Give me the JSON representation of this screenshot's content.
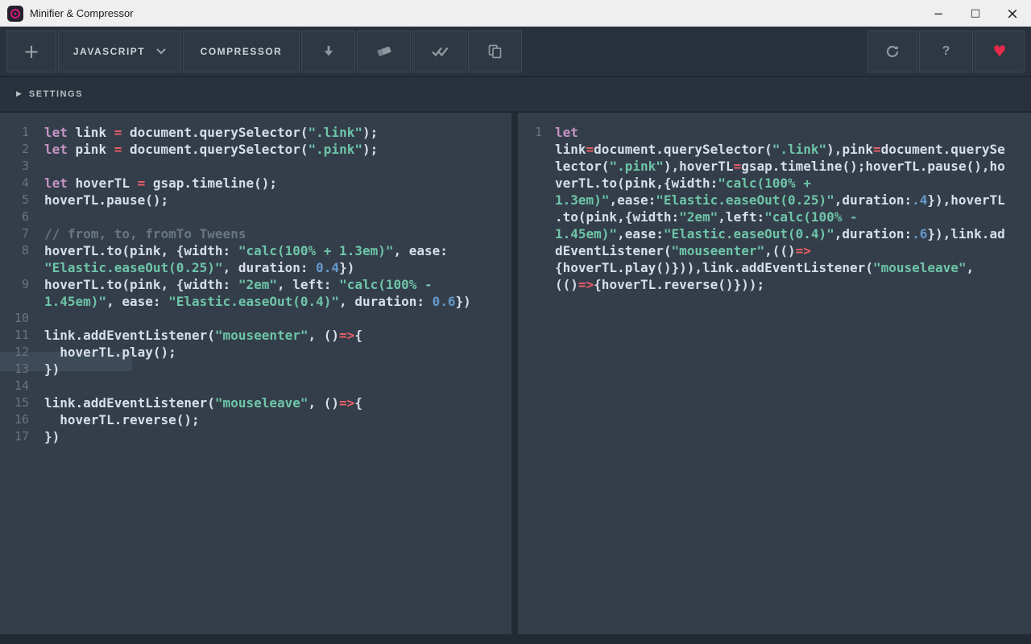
{
  "window": {
    "title": "Minifier & Compressor",
    "controls": {
      "minimize": "−",
      "maximize": "□",
      "close": "×"
    }
  },
  "toolbar": {
    "add": "+",
    "language": "JAVASCRIPT",
    "mode": "COMPRESSOR",
    "help": "?",
    "heart": "♥"
  },
  "settings_bar": {
    "icon": "▶",
    "label": "SETTINGS"
  },
  "colors": {
    "keyword": "#c594c5",
    "plain": "#d8dee9",
    "string": "#6ec5a8",
    "number": "#6699cc",
    "comment": "#697780",
    "operator": "#ec5f67",
    "heart": "#e5294a",
    "logo": "#e3197f"
  },
  "icons": {
    "chevron_down": "v-chevron",
    "download": "down-arrow",
    "eraser": "eraser-shape",
    "verify": "double-check",
    "copy": "two-sheets",
    "refresh": "circular-arrow"
  },
  "source_editor": {
    "rows": [
      {
        "n": "1",
        "t": [
          [
            "kw",
            "let"
          ],
          [
            "pl",
            " link "
          ],
          [
            "op",
            "="
          ],
          [
            "pl",
            " document.querySelector("
          ],
          [
            "str",
            "\".link\""
          ],
          [
            "pl",
            ");"
          ]
        ]
      },
      {
        "n": "2",
        "t": [
          [
            "kw",
            "let"
          ],
          [
            "pl",
            " pink "
          ],
          [
            "op",
            "="
          ],
          [
            "pl",
            " document.querySelector("
          ],
          [
            "str",
            "\".pink\""
          ],
          [
            "pl",
            ");"
          ]
        ]
      },
      {
        "n": "3",
        "t": []
      },
      {
        "n": "4",
        "t": [
          [
            "kw",
            "let"
          ],
          [
            "pl",
            " hoverTL "
          ],
          [
            "op",
            "="
          ],
          [
            "pl",
            " gsap.timeline();"
          ]
        ]
      },
      {
        "n": "5",
        "t": [
          [
            "pl",
            "hoverTL.pause();"
          ]
        ]
      },
      {
        "n": "6",
        "t": []
      },
      {
        "n": "7",
        "t": [
          [
            "com",
            "// from, to, fromTo Tweens"
          ]
        ]
      },
      {
        "n": "8",
        "t": [
          [
            "pl",
            "hoverTL.to(pink, {width: "
          ],
          [
            "str",
            "\"calc(100% + 1.3em)\""
          ],
          [
            "pl",
            ", ease:"
          ]
        ]
      },
      {
        "n": "",
        "t": [
          [
            "str",
            "\"Elastic.easeOut(0.25)\""
          ],
          [
            "pl",
            ", duration: "
          ],
          [
            "num",
            "0.4"
          ],
          [
            "pl",
            "})"
          ]
        ]
      },
      {
        "n": "9",
        "t": [
          [
            "pl",
            "hoverTL.to(pink, {width: "
          ],
          [
            "str",
            "\"2em\""
          ],
          [
            "pl",
            ", left: "
          ],
          [
            "str",
            "\"calc(100% -"
          ]
        ]
      },
      {
        "n": "",
        "t": [
          [
            "str",
            "1.45em)\""
          ],
          [
            "pl",
            ", ease: "
          ],
          [
            "str",
            "\"Elastic.easeOut(0.4)\""
          ],
          [
            "pl",
            ", duration: "
          ],
          [
            "num",
            "0.6"
          ],
          [
            "pl",
            "})"
          ]
        ]
      },
      {
        "n": "10",
        "t": []
      },
      {
        "n": "11",
        "t": [
          [
            "pl",
            "link.addEventListener("
          ],
          [
            "str",
            "\"mouseenter\""
          ],
          [
            "pl",
            ", ()"
          ],
          [
            "op",
            "=>"
          ],
          [
            "pl",
            "{"
          ]
        ]
      },
      {
        "n": "12",
        "t": [
          [
            "pl",
            "  hoverTL.play();"
          ]
        ]
      },
      {
        "n": "13",
        "t": [
          [
            "pl",
            "})"
          ]
        ]
      },
      {
        "n": "14",
        "t": []
      },
      {
        "n": "15",
        "t": [
          [
            "pl",
            "link.addEventListener("
          ],
          [
            "str",
            "\"mouseleave\""
          ],
          [
            "pl",
            ", ()"
          ],
          [
            "op",
            "=>"
          ],
          [
            "pl",
            "{"
          ]
        ]
      },
      {
        "n": "16",
        "t": [
          [
            "pl",
            "  hoverTL.reverse();"
          ]
        ]
      },
      {
        "n": "17",
        "t": [
          [
            "pl",
            "})"
          ]
        ]
      }
    ]
  },
  "output_editor": {
    "rows": [
      {
        "n": "1",
        "t": [
          [
            "kw",
            "let"
          ]
        ]
      },
      {
        "n": "",
        "t": [
          [
            "pl",
            "link"
          ],
          [
            "op",
            "="
          ],
          [
            "pl",
            "document.querySelector("
          ],
          [
            "str",
            "\".link\""
          ],
          [
            "pl",
            "),pink"
          ],
          [
            "op",
            "="
          ],
          [
            "pl",
            "document.querySe"
          ]
        ]
      },
      {
        "n": "",
        "t": [
          [
            "pl",
            "lector("
          ],
          [
            "str",
            "\".pink\""
          ],
          [
            "pl",
            "),hoverTL"
          ],
          [
            "op",
            "="
          ],
          [
            "pl",
            "gsap.timeline();hoverTL.pause(),ho"
          ]
        ]
      },
      {
        "n": "",
        "t": [
          [
            "pl",
            "verTL.to(pink,{width:"
          ],
          [
            "str",
            "\"calc(100% +"
          ]
        ]
      },
      {
        "n": "",
        "t": [
          [
            "str",
            "1.3em)\""
          ],
          [
            "pl",
            ",ease:"
          ],
          [
            "str",
            "\"Elastic.easeOut(0.25)\""
          ],
          [
            "pl",
            ",duration:"
          ],
          [
            "num",
            ".4"
          ],
          [
            "pl",
            "}),hoverTL"
          ]
        ]
      },
      {
        "n": "",
        "t": [
          [
            "pl",
            ".to(pink,{width:"
          ],
          [
            "str",
            "\"2em\""
          ],
          [
            "pl",
            ",left:"
          ],
          [
            "str",
            "\"calc(100% -"
          ]
        ]
      },
      {
        "n": "",
        "t": [
          [
            "str",
            "1.45em)\""
          ],
          [
            "pl",
            ",ease:"
          ],
          [
            "str",
            "\"Elastic.easeOut(0.4)\""
          ],
          [
            "pl",
            ",duration:"
          ],
          [
            "num",
            ".6"
          ],
          [
            "pl",
            "}),link.ad"
          ]
        ]
      },
      {
        "n": "",
        "t": [
          [
            "pl",
            "dEventListener("
          ],
          [
            "str",
            "\"mouseenter\""
          ],
          [
            "pl",
            ",(()"
          ],
          [
            "op",
            "=>"
          ]
        ]
      },
      {
        "n": "",
        "t": [
          [
            "pl",
            "{hoverTL.play()})),link.addEventListener("
          ],
          [
            "str",
            "\"mouseleave\""
          ],
          [
            "pl",
            ","
          ]
        ]
      },
      {
        "n": "",
        "t": [
          [
            "pl",
            "(()"
          ],
          [
            "op",
            "=>"
          ],
          [
            "pl",
            "{hoverTL.reverse()}));"
          ]
        ]
      }
    ]
  }
}
